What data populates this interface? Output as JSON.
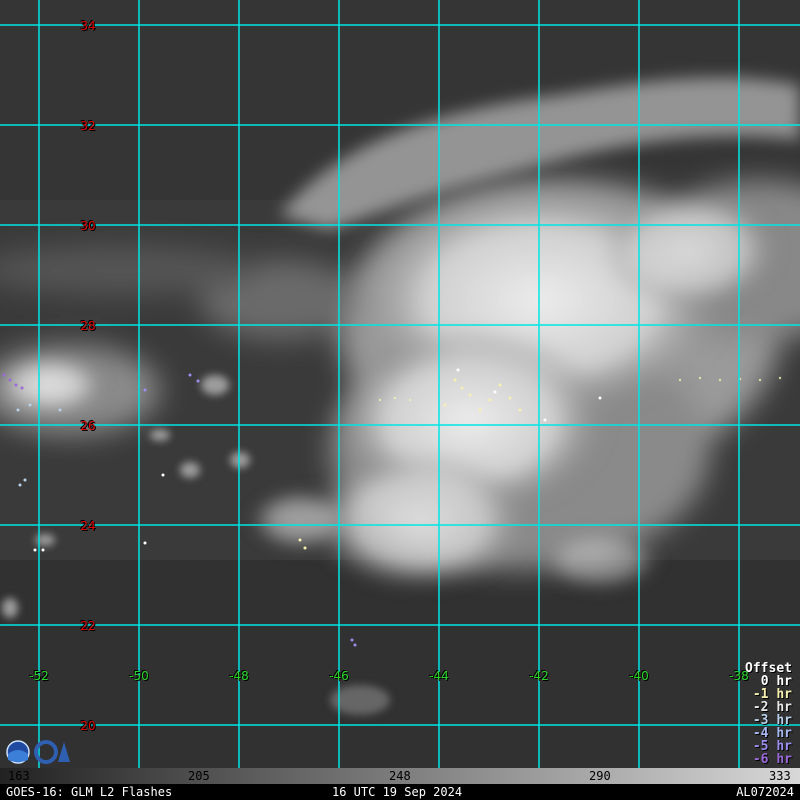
{
  "map": {
    "latitudes": [
      "34",
      "32",
      "30",
      "28",
      "26",
      "24",
      "22",
      "20"
    ],
    "longitudes": [
      "-52",
      "-50",
      "-48",
      "-46",
      "-44",
      "-42",
      "-40",
      "-38"
    ],
    "grid_color": "#00e5e5",
    "lat_label_color": "#e00000",
    "lon_label_color": "#2bd62b"
  },
  "legend": {
    "title": "Offset",
    "entries": [
      {
        "label": "0 hr",
        "color": "#ffffff"
      },
      {
        "label": "-1 hr",
        "color": "#f5f0b0"
      },
      {
        "label": "-2 hr",
        "color": "#e8e8e8"
      },
      {
        "label": "-3 hr",
        "color": "#b8d0e8"
      },
      {
        "label": "-4 hr",
        "color": "#a8b8f0"
      },
      {
        "label": "-5 hr",
        "color": "#9a8ef0"
      },
      {
        "label": "-6 hr",
        "color": "#9a6ad8"
      }
    ]
  },
  "colorbar": {
    "ticks": [
      "163",
      "205",
      "248",
      "290",
      "333"
    ]
  },
  "footer": {
    "left": "GOES-16: GLM L2 Flashes",
    "center": "16 UTC 19 Sep 2024",
    "right": "AL072024"
  }
}
